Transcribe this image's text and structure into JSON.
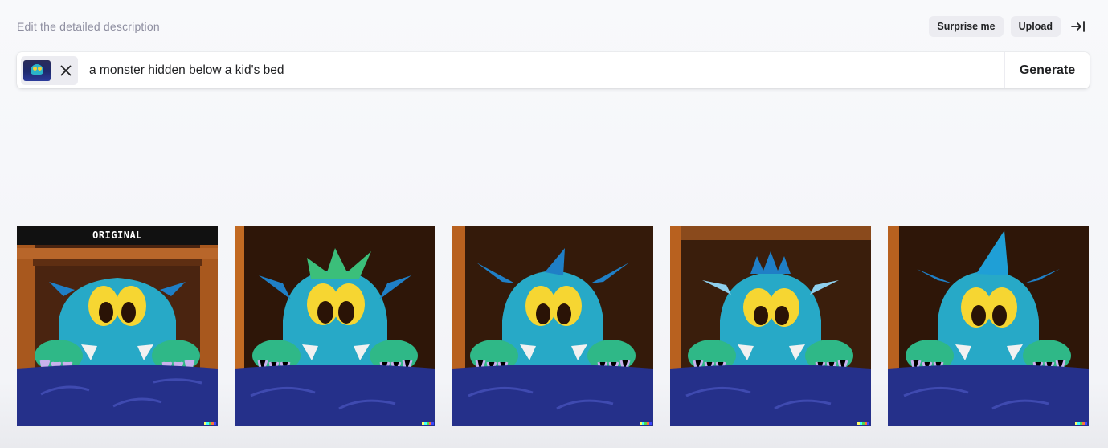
{
  "header": {
    "hint": "Edit the detailed description",
    "surprise_label": "Surprise me",
    "upload_label": "Upload"
  },
  "prompt_bar": {
    "value": "a monster hidden below a kid's bed",
    "generate_label": "Generate"
  },
  "results": {
    "original_label": "ORIGINAL",
    "count": 5
  },
  "icons": {
    "collapse": "arrow-right-to-bar-icon",
    "clear": "close-icon"
  },
  "colors": {
    "background": "#f7f7f8",
    "pill": "#ececf1",
    "monster_body": "#27a9c7",
    "monster_eyes": "#f6d632",
    "blanket": "#25308a"
  }
}
